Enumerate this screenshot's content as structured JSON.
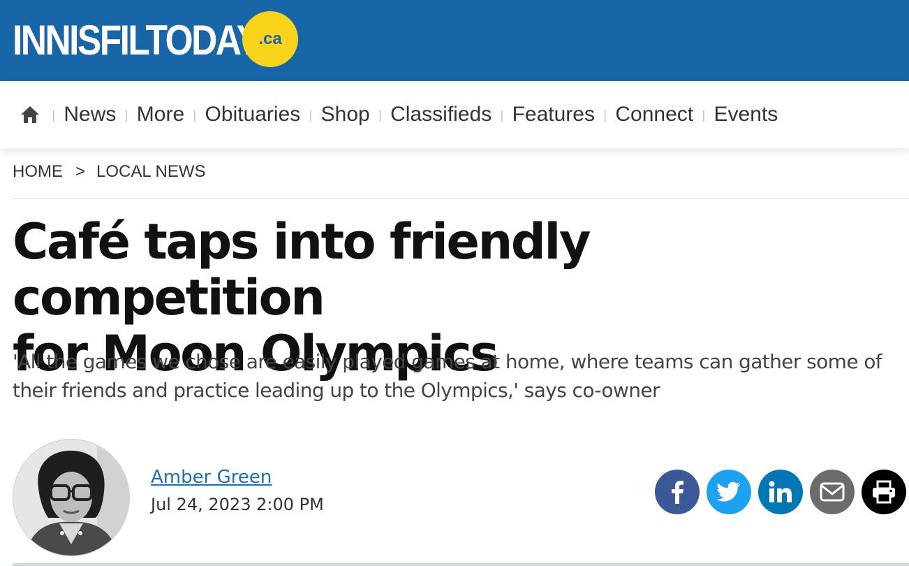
{
  "header": {
    "logo_text": "INNISFILTODAY",
    "logo_badge": ".ca",
    "colors": {
      "brand_blue": "#1865a8",
      "badge_yellow": "#f9d31c"
    }
  },
  "nav": {
    "home_icon": "home-icon",
    "items": [
      "News",
      "More",
      "Obituaries",
      "Shop",
      "Classifieds",
      "Features",
      "Connect",
      "Events"
    ]
  },
  "breadcrumb": {
    "home": "HOME",
    "separator": ">",
    "section": "LOCAL NEWS"
  },
  "article": {
    "title_line1": "Café taps into friendly competition",
    "title_line2": "for Moon Olympics",
    "subtitle": "'All the games we chose are easily played games at home, where teams can gather some of their friends and practice leading up to the Olympics,' says co-owner",
    "author": "Amber Green",
    "date": "Jul 24, 2023 2:00 PM"
  },
  "share": {
    "buttons": [
      {
        "name": "facebook-icon",
        "color": "#3b5998"
      },
      {
        "name": "twitter-icon",
        "color": "#1da1f2"
      },
      {
        "name": "linkedin-icon",
        "color": "#0077b5"
      },
      {
        "name": "email-icon",
        "color": "#6b6b6b"
      },
      {
        "name": "print-icon",
        "color": "#000000"
      }
    ]
  }
}
